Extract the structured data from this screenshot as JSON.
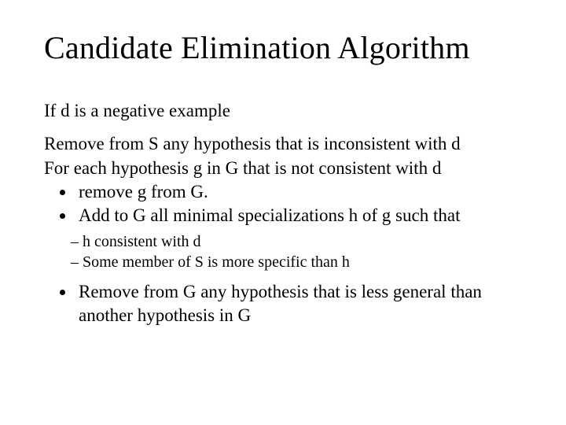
{
  "title": "Candidate Elimination Algorithm",
  "intro": "If d is a negative example",
  "line1": "Remove from S any hypothesis that is inconsistent with d",
  "line2": "For each hypothesis g in G that is not consistent with d",
  "bullets1": [
    "remove g from G.",
    "Add to G all minimal specializations h of g such that"
  ],
  "subbullets": [
    "h consistent with d",
    "Some member of S is more specific than h"
  ],
  "bullets2": [
    "Remove from G any hypothesis that is less general than another hypothesis in G"
  ]
}
